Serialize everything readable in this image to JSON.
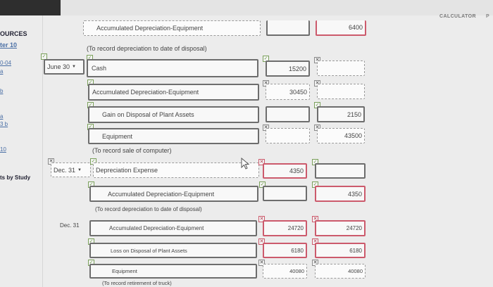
{
  "header": {
    "calculator": "CALCULATOR",
    "cut": "P"
  },
  "sidebar": {
    "resources": "OURCES",
    "chapter": "ter 10",
    "links": [
      "0-04",
      "a",
      "b",
      "a",
      "3 b",
      "10"
    ],
    "study": "ts by Study"
  },
  "entries": {
    "top_account": "Accumulated Depreciation-Equipment",
    "top_credit": "6400",
    "note1": "(To record depreciation to date of disposal)",
    "date1": "June 30",
    "r1_account": "Cash",
    "r1_debit": "15200",
    "r2_account": "Accumulated Depreciation-Equipment",
    "r2_debit": "30450",
    "r3_account": "Gain on Disposal of Plant Assets",
    "r3_credit": "2150",
    "r4_account": "Equipment",
    "r4_credit": "43500",
    "note2": "(To record sale of computer)",
    "date2": "Dec. 31",
    "r5_account": "Depreciation Expense",
    "r5_debit": "4350",
    "r6_account": "Accumulated Depreciation-Equipment",
    "r6_credit": "4350",
    "note3": "(To record depreciation to date of disposal)",
    "date3": "Dec. 31",
    "r7_account": "Accumulated Depreciation-Equipment",
    "r7_debit": "24720",
    "r7_credit": "24720",
    "r8_account": "Loss on Disposal of Plant Assets",
    "r8_debit": "6180",
    "r8_credit": "6180",
    "r9_account": "Equipment",
    "r9_debit": "40080",
    "r9_credit": "40080",
    "note4": "(To record retirement of truck)"
  }
}
